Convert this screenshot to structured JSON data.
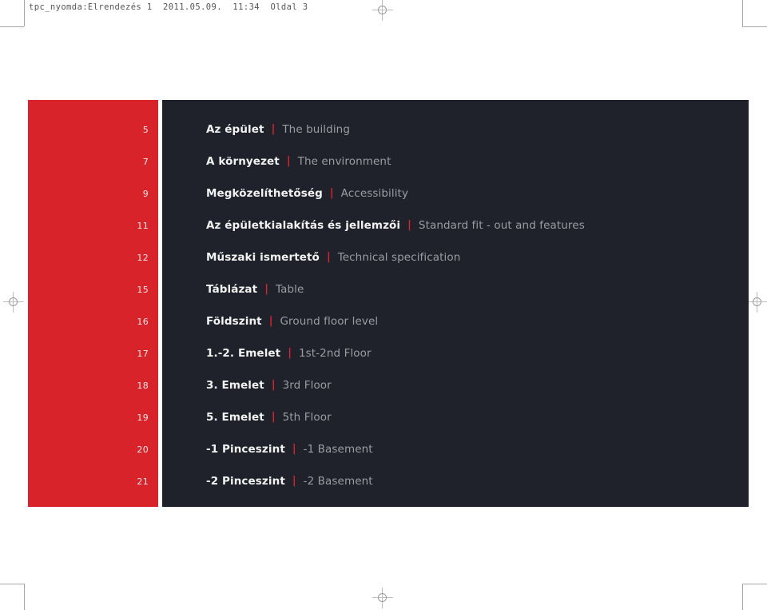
{
  "slug": {
    "text": "tpc_nyomda:Elrendezés 1  2011.05.09.  11:34  Oldal 3"
  },
  "colors": {
    "accent_red": "#d8232a",
    "panel_dark": "#1f222a",
    "page_number": "#f0e6e6",
    "hungarian_text": "#f2f2f2",
    "english_text": "#9a9da4",
    "paper": "#ffffff",
    "crop_mark": "#a8a8a8"
  },
  "toc": {
    "separator": "|",
    "entries": [
      {
        "page": "5",
        "hu": "Az épület",
        "en": "The building"
      },
      {
        "page": "7",
        "hu": "A környezet",
        "en": "The environment"
      },
      {
        "page": "9",
        "hu": "Megközelíthetőség",
        "en": "Accessibility"
      },
      {
        "page": "11",
        "hu": "Az épületkialakítás és jellemzői",
        "en": "Standard fit - out and features"
      },
      {
        "page": "12",
        "hu": "Műszaki ismertető",
        "en": "Technical specification"
      },
      {
        "page": "15",
        "hu": "Táblázat",
        "en": "Table"
      },
      {
        "page": "16",
        "hu": "Földszint",
        "en": "Ground floor level"
      },
      {
        "page": "17",
        "hu": "1.-2. Emelet",
        "en": "1st-2nd Floor"
      },
      {
        "page": "18",
        "hu": "3. Emelet",
        "en": "3rd Floor"
      },
      {
        "page": "19",
        "hu": "5. Emelet",
        "en": "5th Floor"
      },
      {
        "page": "20",
        "hu": "-1 Pinceszint",
        "en": "-1 Basement"
      },
      {
        "page": "21",
        "hu": "-2 Pinceszint",
        "en": "-2 Basement"
      }
    ]
  }
}
